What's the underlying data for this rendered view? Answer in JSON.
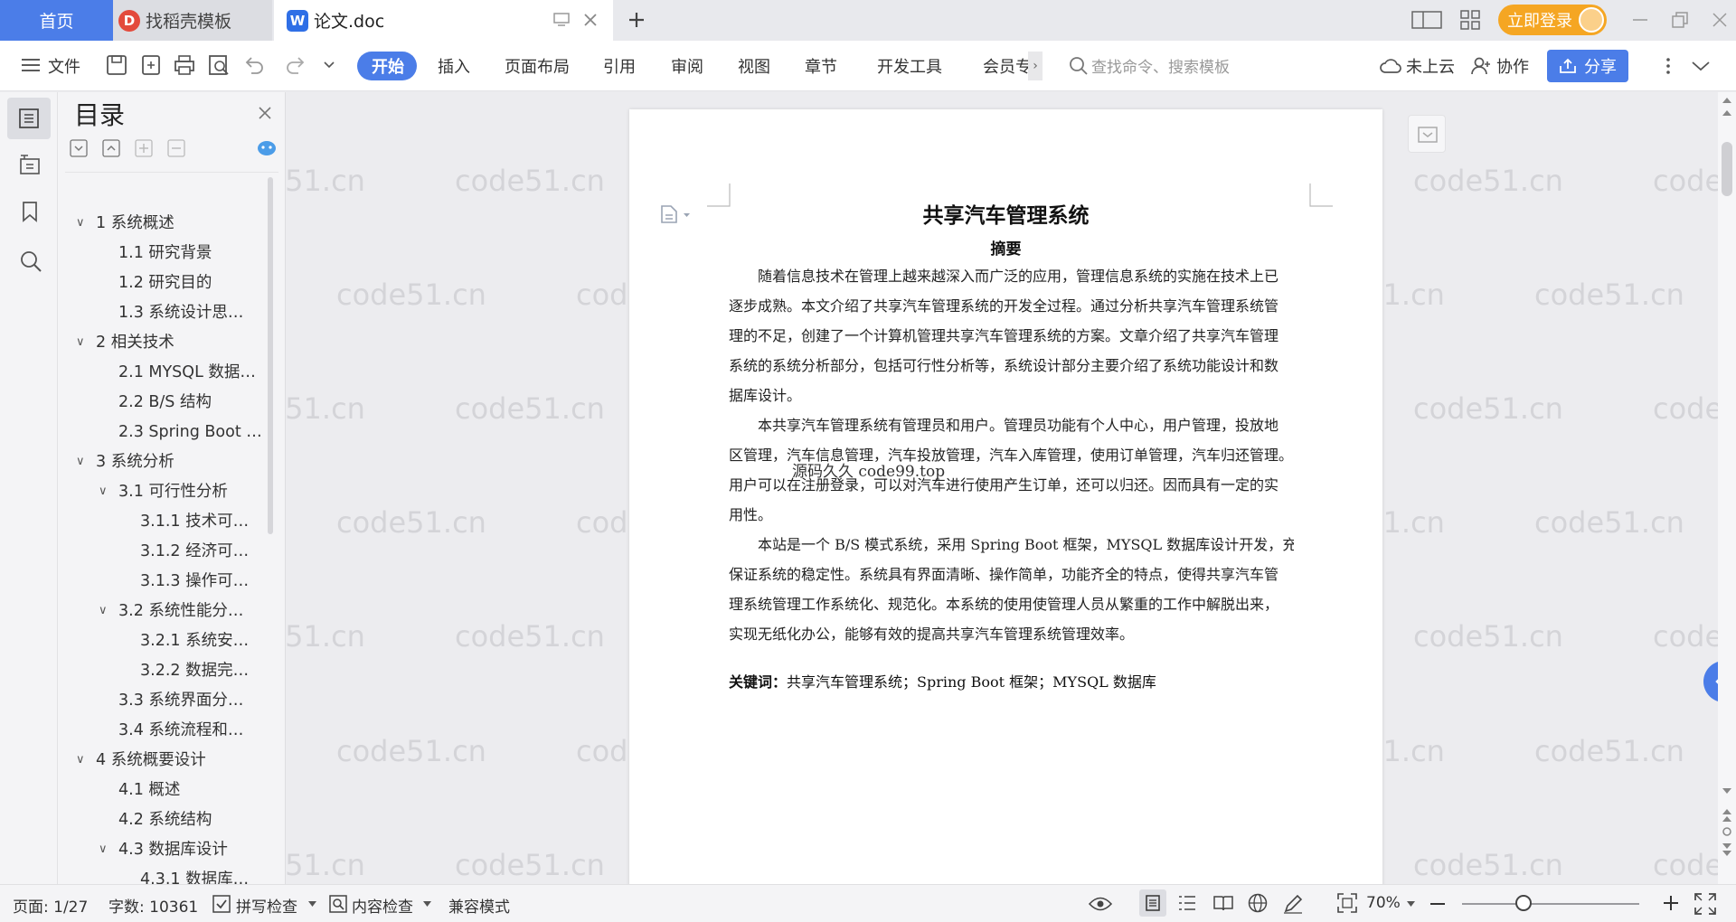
{
  "titlebar": {
    "tab_home": "首页",
    "tab_daoke": "找稻壳模板",
    "tab_doc": "论文.doc",
    "login": "立即登录"
  },
  "toolbar": {
    "file": "文件",
    "tabs": [
      "开始",
      "插入",
      "页面布局",
      "引用",
      "审阅",
      "视图",
      "章节",
      "开发工具",
      "会员专"
    ],
    "search_placeholder": "查找命令、搜索模板",
    "cloud": "未上云",
    "collab": "协作",
    "share": "分享"
  },
  "toc": {
    "title": "目录",
    "items": [
      "1 系统概述",
      "1.1 研究背景",
      "1.2 研究目的",
      "1.3 系统设计思…",
      "2 相关技术",
      "2.1 MYSQL 数据…",
      "2.2 B/S 结构",
      "2.3 Spring Boot …",
      "3 系统分析",
      "3.1 可行性分析",
      "3.1.1 技术可…",
      "3.1.2 经济可…",
      "3.1.3 操作可…",
      "3.2 系统性能分…",
      "3.2.1 系统安…",
      "3.2.2 数据完…",
      "3.3 系统界面分…",
      "3.4 系统流程和…",
      "4 系统概要设计",
      "4.1 概述",
      "4.2 系统结构",
      "4.3 数据库设计",
      "4.3.1 数据库…"
    ]
  },
  "document": {
    "title": "共享汽车管理系统",
    "subtitle": "摘要",
    "lines": [
      "随着信息技术在管理上越来越深入而广泛的应用，管理信息系统的实施在技术上已",
      "逐步成熟。本文介绍了共享汽车管理系统的开发全过程。通过分析共享汽车管理系统管",
      "理的不足，创建了一个计算机管理共享汽车管理系统的方案。文章介绍了共享汽车管理",
      "系统的系统分析部分，包括可行性分析等，系统设计部分主要介绍了系统功能设计和数",
      "据库设计。",
      "本共享汽车管理系统有管理员和用户。管理员功能有个人中心，用户管理，投放地",
      "区管理，汽车信息管理，汽车投放管理，汽车入库管理，使用订单管理，汽车归还管理。",
      "用户可以在注册登录，可以对汽车进行使用产生订单，还可以归还。因而具有一定的实",
      "用性。",
      "本站是一个 B/S 模式系统，采用 Spring Boot 框架，MYSQL 数据库设计开发，充分",
      "保证系统的稳定性。系统具有界面清晰、操作简单，功能齐全的特点，使得共享汽车管",
      "理系统管理工作系统化、规范化。本系统的使用使管理人员从繁重的工作中解脱出来，",
      "实现无纸化办公，能够有效的提高共享汽车管理系统管理效率。"
    ],
    "keywords_label": "关键词：",
    "keywords": "共享汽车管理系统；Spring Boot 框架；MYSQL 数据库",
    "overlay_text": "源码久久 code99.top"
  },
  "watermark": "code51.cn",
  "statusbar": {
    "page": "页面: 1/27",
    "words": "字数: 10361",
    "spell": "拼写检查",
    "content": "内容检查",
    "compat": "兼容模式",
    "zoom": "70%"
  },
  "colors": {
    "accent": "#4b7de8",
    "login": "#f5a623",
    "active_tab": "#4b7de8"
  }
}
